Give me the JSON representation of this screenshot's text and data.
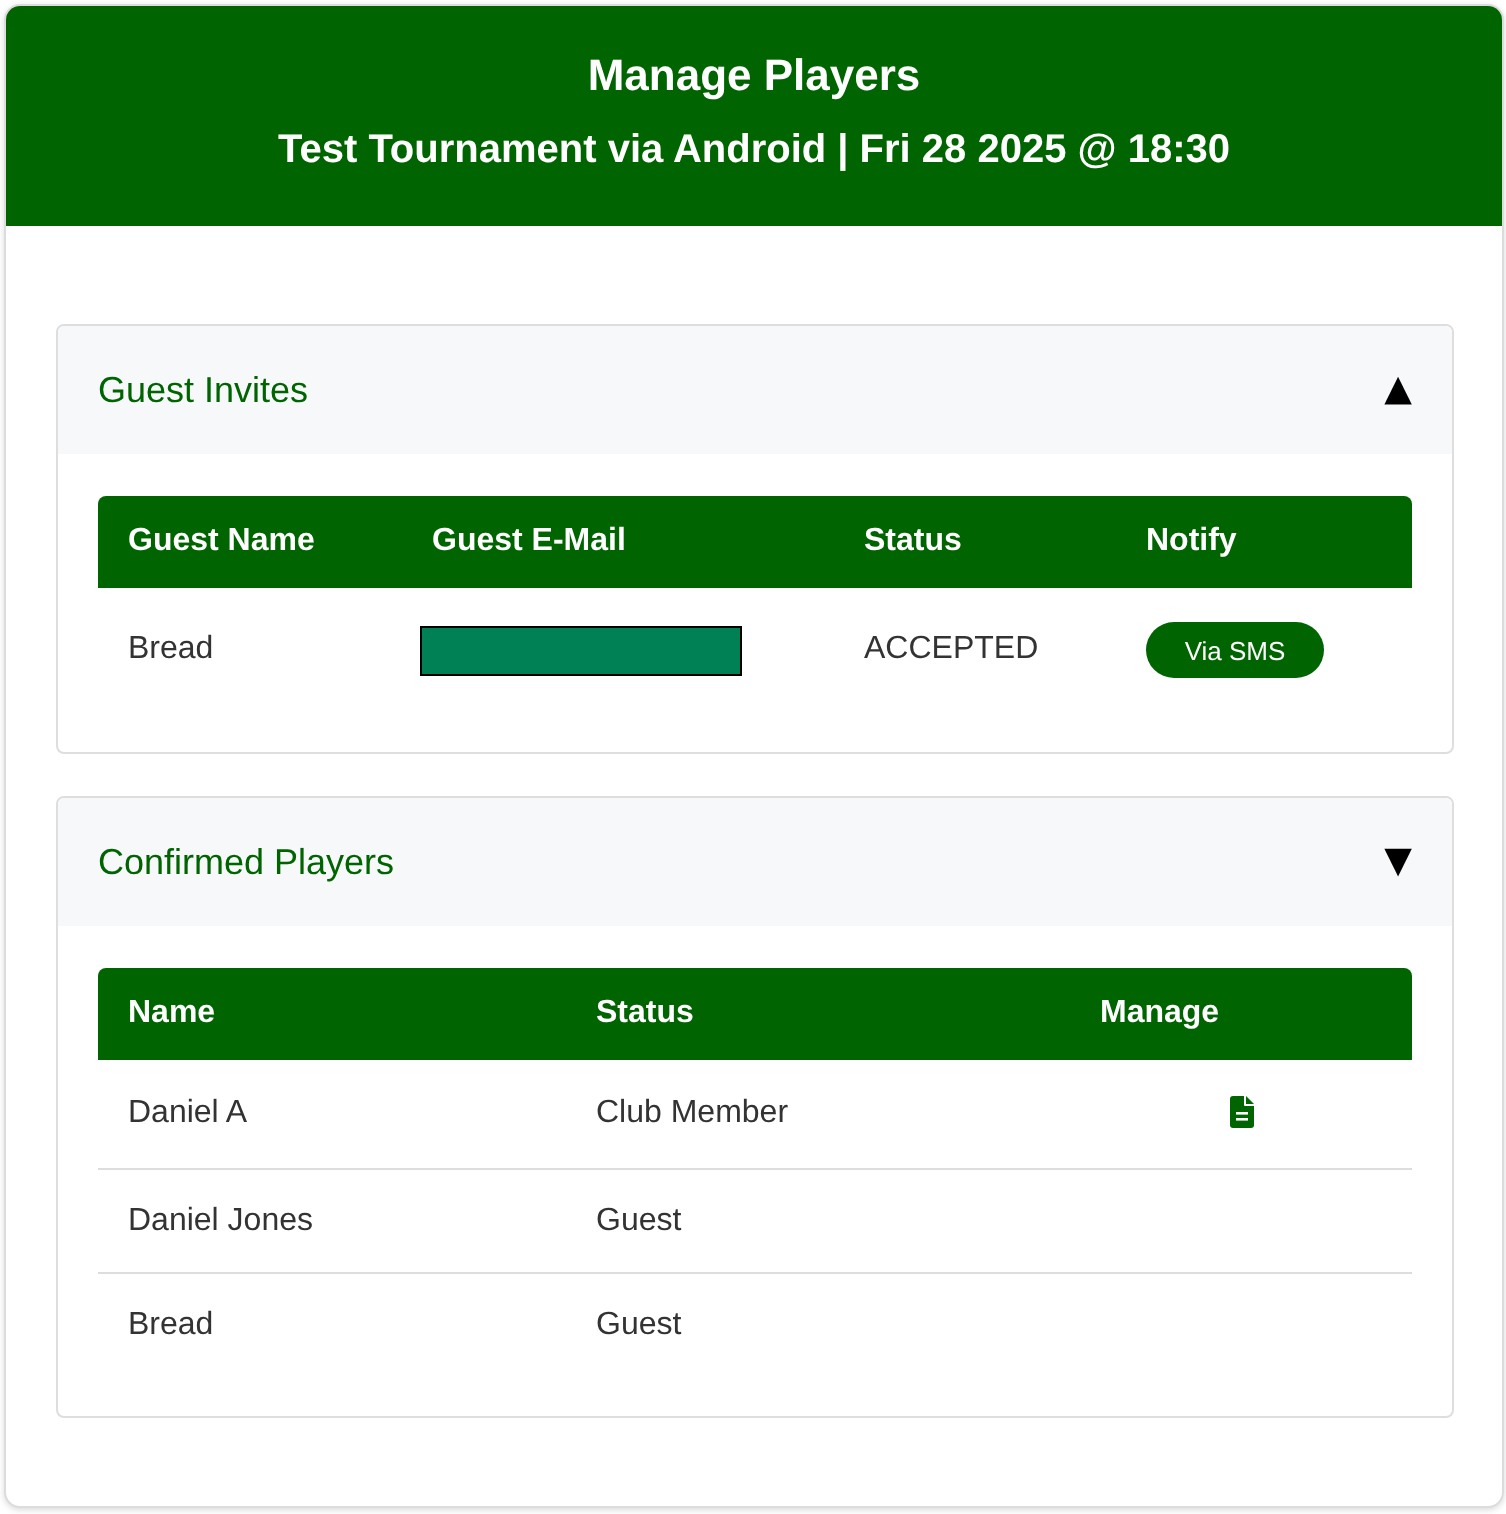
{
  "header": {
    "title": "Manage Players",
    "subtitle": "Test Tournament via Android | Fri 28 2025 @ 18:30"
  },
  "guest_invites": {
    "title": "Guest Invites",
    "toggle": "▲",
    "columns": [
      "Guest Name",
      "Guest E-Mail",
      "Status",
      "Notify"
    ],
    "rows": [
      {
        "name": "Bread",
        "email_redacted": true,
        "status": "ACCEPTED",
        "notify_button": "Via SMS"
      }
    ]
  },
  "confirmed_players": {
    "title": "Confirmed Players",
    "toggle": "▼",
    "columns": [
      "Name",
      "Status",
      "Manage"
    ],
    "rows": [
      {
        "name": "Daniel A",
        "status": "Club Member",
        "manage_document": true
      },
      {
        "name": "Daniel Jones",
        "status": "Guest",
        "manage_document": false
      },
      {
        "name": "Bread",
        "status": "Guest",
        "manage_document": false
      }
    ]
  }
}
